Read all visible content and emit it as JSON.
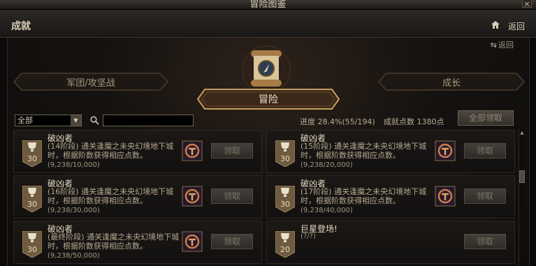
{
  "window": {
    "title": "冒险图鉴",
    "close_glyph": "×"
  },
  "header": {
    "title": "成就",
    "back_label": "返回"
  },
  "subnav": {
    "back_label": "返回"
  },
  "categories": {
    "left": "军团/攻坚战",
    "center": "冒险",
    "right": "成长"
  },
  "filter": {
    "selected": "全部",
    "search_placeholder": ""
  },
  "stats": {
    "progress": "进度  28.4%(55/194)",
    "points": "成就点数  1380点"
  },
  "claim_all_label": "全部领取",
  "achievements": [
    {
      "badge": "30",
      "name": "破凶者",
      "desc": "(14阶段) 通关逢魔之未央幻境地下城时，根据阶数获得相应点数。",
      "progress": "(9,238/10,000)",
      "claim": "领取"
    },
    {
      "badge": "30",
      "name": "破凶者",
      "desc": "(15阶段) 通关逢魔之未央幻境地下城时，根据阶数获得相应点数。",
      "progress": "(9,238/20,000)",
      "claim": "领取"
    },
    {
      "badge": "30",
      "name": "破凶者",
      "desc": "(16阶段) 通关逢魔之未央幻境地下城时，根据阶数获得相应点数。",
      "progress": "(9,238/30,000)",
      "claim": "领取"
    },
    {
      "badge": "30",
      "name": "破凶者",
      "desc": "(17阶段) 通关逢魔之未央幻境地下城时，根据阶数获得相应点数。",
      "progress": "(9,238/40,000)",
      "claim": "领取"
    },
    {
      "badge": "30",
      "name": "破凶者",
      "desc": "(最终阶段) 通关逢魔之未央幻境地下城时，根据阶数获得相应点数。",
      "progress": "(9,238/50,000)",
      "claim": "领取"
    },
    {
      "badge": "20",
      "name": "巨星登场!",
      "desc": "",
      "progress": "(?/?)",
      "claim": "领取"
    }
  ]
}
